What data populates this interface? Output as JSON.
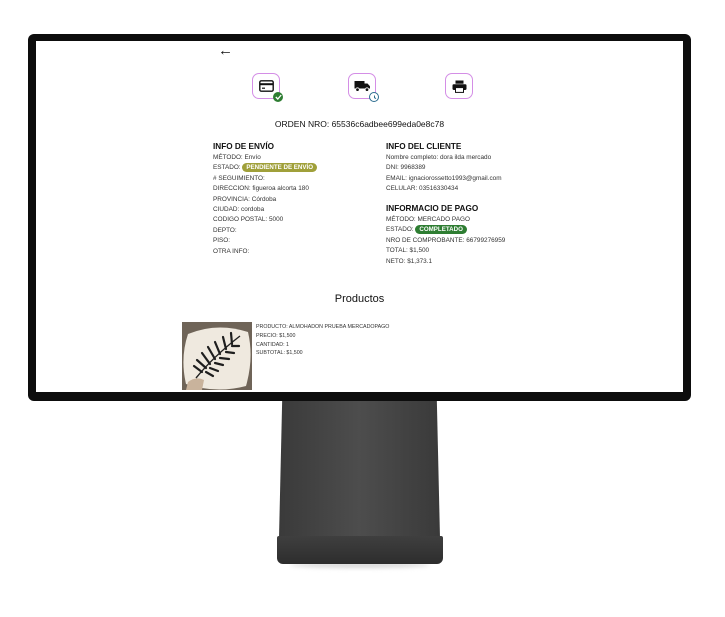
{
  "navigation": {
    "back_icon": "arrow-left-icon"
  },
  "steps": [
    {
      "icon": "credit-card-icon",
      "status_icon": "check-circle-icon",
      "status_color": "#2e7d32"
    },
    {
      "icon": "truck-icon",
      "status_icon": "clock-icon",
      "status_color": "#2b6c8f"
    },
    {
      "icon": "printer-icon"
    }
  ],
  "order": {
    "title": "ORDEN NRO: 65536c6adbee699eda0e8c78"
  },
  "shipping": {
    "heading": "INFO DE ENVÍO",
    "method": "MÉTODO: Envío",
    "status_label": "ESTADO:",
    "status_badge": "PENDIENTE DE ENVÍO",
    "status_color": "#a0a03a",
    "tracking": "# SEGUIMIENTO:",
    "address": "DIRECCION: figueroa alcorta 180",
    "province": "PROVINCIA: Córdoba",
    "city": "CIUDAD: cordoba",
    "postal_code": "CODIGO POSTAL: 5000",
    "apartment": "DEPTO:",
    "floor": "PISO:",
    "other_info": "OTRA INFO:"
  },
  "client": {
    "heading": "INFO DEL CLIENTE",
    "full_name": "Nombre completo: dora ilda mercado",
    "dni": "DNI: 9968389",
    "email": "EMAIL: ignaciorossetto1993@gmail.com",
    "phone": "CELULAR: 03516330434"
  },
  "payment": {
    "heading": "INFORMACIO DE PAGO",
    "method": "MÉTODO: MERCADO PAGO",
    "status_label": "ESTADO:",
    "status_badge": "COMPLETADO",
    "status_color": "#2e7d32",
    "receipt": "NRO DE COMPROBANTE: 66799276959",
    "total": "TOTAL: $1,500",
    "net": "NETO: $1,373.1"
  },
  "products": {
    "heading": "Productos",
    "items": [
      {
        "product": "PRODUCTO: ALMOHADON PRUEBA MERCADOPAGO",
        "price": "PRECIO: $1,500",
        "quantity": "CANTIDAD: 1",
        "subtotal": "SUBTOTAL: $1,500"
      }
    ]
  }
}
